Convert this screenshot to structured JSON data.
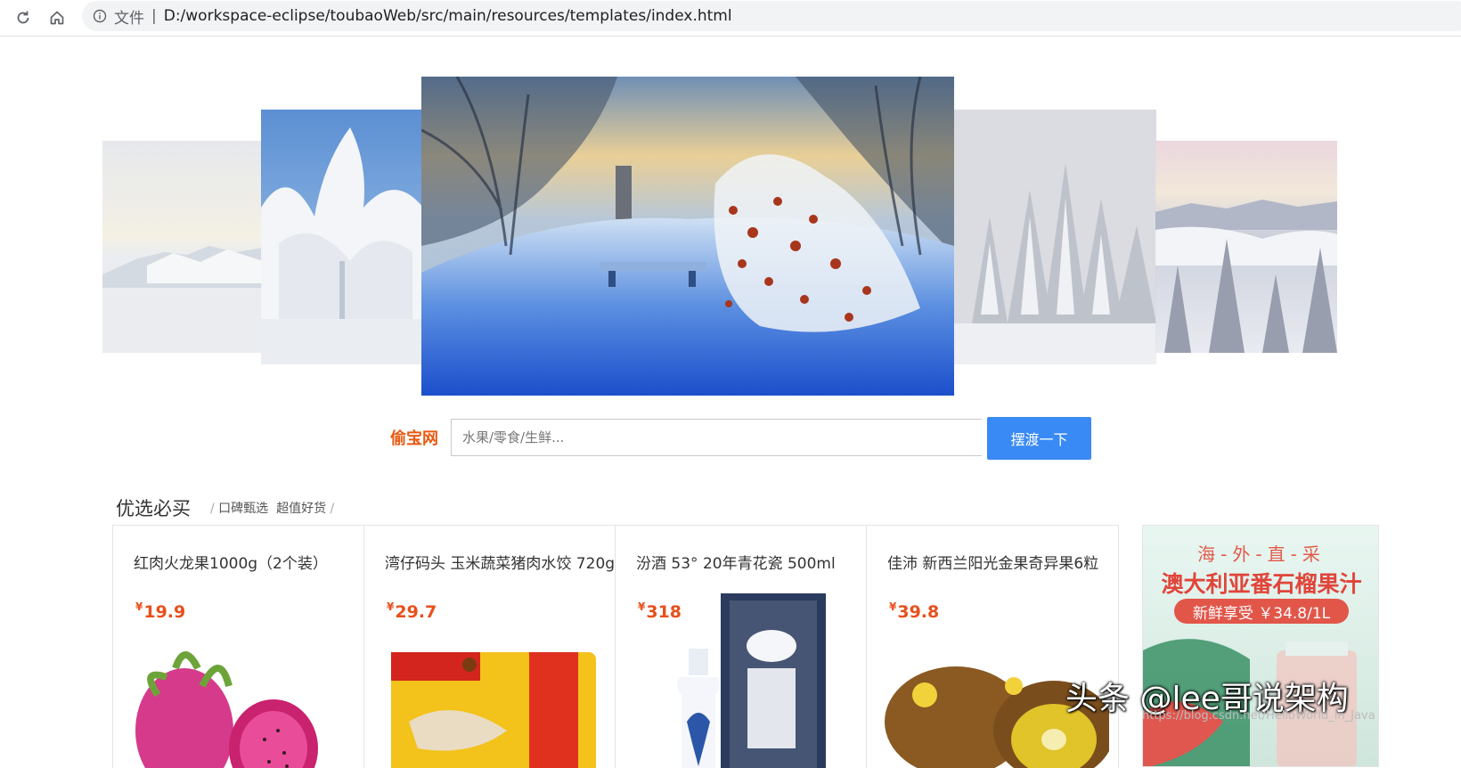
{
  "browser": {
    "scheme_label": "文件",
    "separator": "|",
    "url": "D:/workspace-eclipse/toubaoWeb/src/main/resources/templates/index.html",
    "reload_icon": "reload-icon",
    "home_icon": "home-icon",
    "info_icon": "info-icon"
  },
  "search": {
    "brand": "偷宝网",
    "placeholder": "水果/零食/生鲜...",
    "button_label": "摆渡一下",
    "button_color": "#3a8af5",
    "brand_color": "#e85a12"
  },
  "section": {
    "title": "优选必买",
    "subtitle_items": [
      "口碑甄选",
      "超值好货"
    ],
    "slash": "/"
  },
  "products": [
    {
      "title": "红肉火龙果1000g（2个装）",
      "currency": "¥",
      "price": "19.9"
    },
    {
      "title": "湾仔码头 玉米蔬菜猪肉水饺 720g",
      "currency": "¥",
      "price": "29.7"
    },
    {
      "title": "汾酒 53°  20年青花瓷 500ml",
      "currency": "¥",
      "price": "318"
    },
    {
      "title": "佳沛  新西兰阳光金果奇异果6粒",
      "currency": "¥",
      "price": "39.8"
    }
  ],
  "ad": {
    "line1": "海-外-直-采",
    "line2": "澳大利亚番石榴果汁",
    "line3": "新鲜享受 ￥34.8/1L"
  },
  "watermark": {
    "main": "头条 @lee哥说架构",
    "url": "https://blog.csdn.net/HelloWorld_in_Java"
  }
}
